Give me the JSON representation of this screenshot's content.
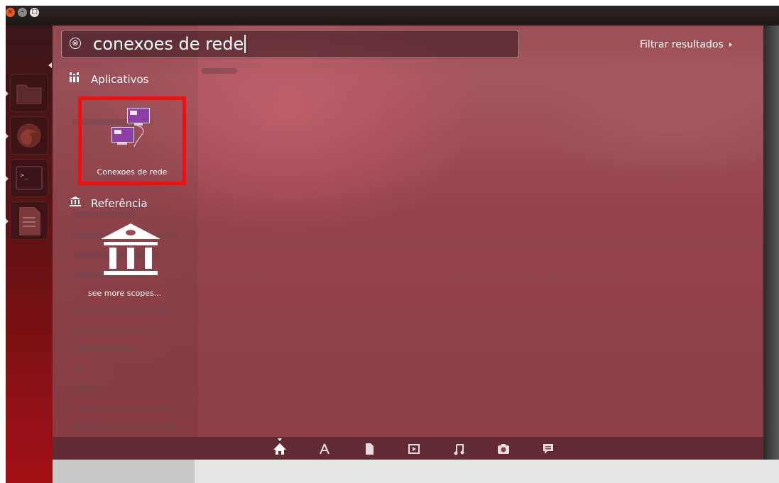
{
  "window": {
    "close": "×",
    "minimize": "–",
    "maximize": "□"
  },
  "search": {
    "query": "conexoes de rede",
    "clear_symbol": "⊗"
  },
  "filter": {
    "label": "Filtrar resultados"
  },
  "categories": {
    "apps": {
      "label": "Aplicativos"
    },
    "reference": {
      "label": "Referência"
    }
  },
  "results": {
    "app": {
      "label": "Conexoes de rede"
    },
    "scopes": {
      "label": "see more scopes..."
    }
  },
  "lenses": [
    "home-icon",
    "apps-icon",
    "files-icon",
    "video-icon",
    "music-icon",
    "photo-icon",
    "social-icon"
  ],
  "colors": {
    "highlight": "#f30e0e",
    "dash": "#9b4e56",
    "launcher": "#a31015"
  }
}
